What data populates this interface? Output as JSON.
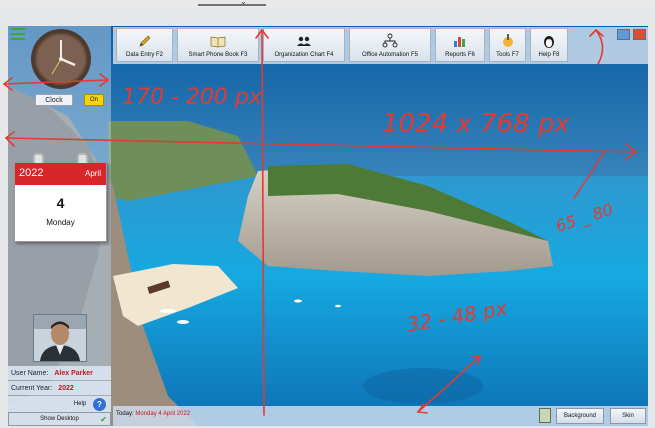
{
  "toolbar": {
    "buttons": [
      {
        "label": "Data Entry F2",
        "icon": "pencil-icon"
      },
      {
        "label": "Smart Phone Book F3",
        "icon": "book-icon"
      },
      {
        "label": "Organization Chart F4",
        "icon": "people-icon"
      },
      {
        "label": "Office Automation F5",
        "icon": "org-chart-icon"
      },
      {
        "label": "Reports F6",
        "icon": "chart-icon"
      },
      {
        "label": "Tools F7",
        "icon": "tools-icon"
      },
      {
        "label": "Help F8",
        "icon": "penguin-icon"
      }
    ]
  },
  "sidebar": {
    "clock_label": "Clock",
    "on_label": "On",
    "calendar": {
      "year": "2022",
      "month": "April",
      "day": "4",
      "weekday": "Monday"
    },
    "user_name_label": "User Name:",
    "user_name": "Alex Parker",
    "current_year_label": "Current Year:",
    "current_year": "2022",
    "help_label": "Help",
    "show_desktop_label": "Show Desktop"
  },
  "status": {
    "today_label": "Today:",
    "today_value": "Monday 4 April 2022",
    "background_label": "Background",
    "skin_label": "Skin"
  },
  "annotations": {
    "sidebar_width": "170 - 200 px",
    "screen_size": "1024 x 768 px",
    "toolbar_height": "65 _ 80",
    "statusbar_height": "32 - 48 px"
  },
  "colors": {
    "annotation": "#e33a32",
    "accent_red": "#c8161d",
    "calendar_red": "#d8262a"
  }
}
